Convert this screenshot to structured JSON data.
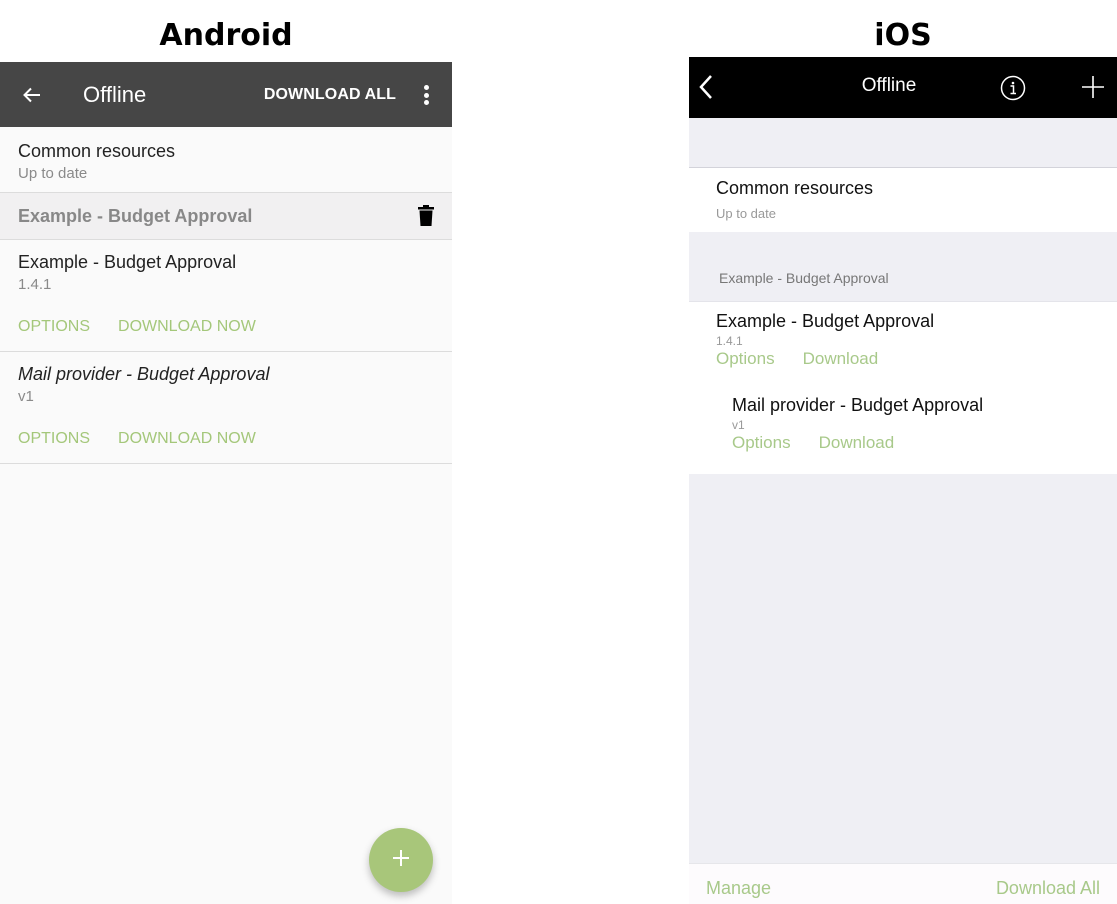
{
  "labels": {
    "android": "Android",
    "ios": "iOS"
  },
  "android": {
    "toolbar": {
      "back_icon": "arrow-left-icon",
      "title": "Offline",
      "download_all": "DOWNLOAD ALL",
      "more_icon": "more-vertical-icon"
    },
    "common": {
      "title": "Common resources",
      "status": "Up to date"
    },
    "group": {
      "title": "Example - Budget Approval",
      "delete_icon": "trash-icon"
    },
    "items": [
      {
        "title": "Example - Budget Approval",
        "version": "1.4.1",
        "italic": false,
        "options": "OPTIONS",
        "download": "DOWNLOAD NOW"
      },
      {
        "title": "Mail provider - Budget Approval",
        "version": "v1",
        "italic": true,
        "options": "OPTIONS",
        "download": "DOWNLOAD NOW"
      }
    ],
    "fab_icon": "plus-icon",
    "colors": {
      "toolbar": "#464646",
      "accent": "#a4c77a",
      "fab": "#a8c67a"
    }
  },
  "ios": {
    "navbar": {
      "back_icon": "chevron-left-icon",
      "title": "Offline",
      "info_icon": "info-icon",
      "add_icon": "plus-icon"
    },
    "common": {
      "title": "Common resources",
      "status": "Up to date"
    },
    "section_header": "Example - Budget Approval",
    "items": [
      {
        "title": "Example - Budget Approval",
        "version": "1.4.1",
        "options": "Options",
        "download": "Download"
      },
      {
        "title": "Mail provider - Budget Approval",
        "version": "v1",
        "options": "Options",
        "download": "Download"
      }
    ],
    "bottom_bar": {
      "manage": "Manage",
      "download_all": "Download All"
    },
    "colors": {
      "navbar": "#000000",
      "background": "#efeff4",
      "accent": "#a8c98a"
    }
  }
}
